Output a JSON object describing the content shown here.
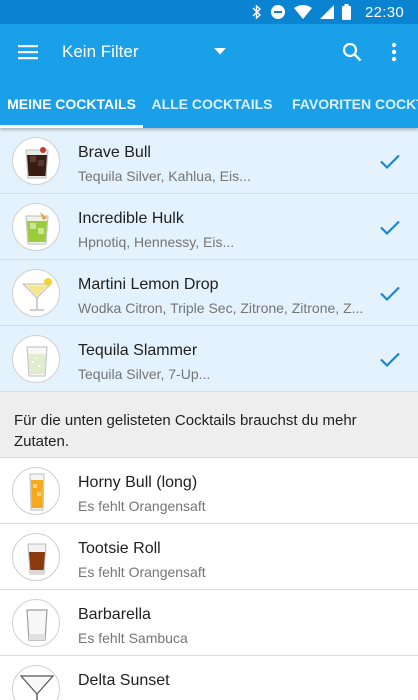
{
  "status_bar": {
    "time": "22:30",
    "icons": [
      "bluetooth-icon",
      "do-not-disturb-icon",
      "wifi-icon",
      "cell-signal-icon",
      "battery-icon"
    ]
  },
  "app_bar": {
    "filter_label": "Kein Filter",
    "icons": [
      "menu-icon",
      "dropdown-caret-icon",
      "search-icon",
      "more-vert-icon"
    ]
  },
  "tabs": [
    {
      "label": "MEINE COCKTAILS",
      "selected": true
    },
    {
      "label": "ALLE COCKTAILS",
      "selected": false
    },
    {
      "label": "FAVORITEN COCKTAILS",
      "selected": false
    }
  ],
  "colors": {
    "status_bar": "#0a84d0",
    "app_bar": "#1aa0e8",
    "available_row": "#e3f2fd",
    "check": "#1a84d0"
  },
  "available": [
    {
      "name": "Brave Bull",
      "ingredients": "Tequila Silver, Kahlua, Eis...",
      "image": "dark-lowball-glass-icon"
    },
    {
      "name": "Incredible Hulk",
      "ingredients": "Hpnotiq, Hennessy, Eis...",
      "image": "green-lowball-glass-icon"
    },
    {
      "name": "Martini Lemon Drop",
      "ingredients": "Wodka Citron, Triple Sec, Zitrone, Zitrone, Z...",
      "image": "martini-glass-icon"
    },
    {
      "name": "Tequila Slammer",
      "ingredients": "Tequila Silver, 7-Up...",
      "image": "clear-lowball-glass-icon"
    }
  ],
  "missing_info": "Für die unten gelisteten Cocktails brauchst du mehr Zutaten.",
  "missing": [
    {
      "name": "Horny Bull (long)",
      "missing": "Es fehlt Orangensaft",
      "image": "orange-highball-glass-icon"
    },
    {
      "name": "Tootsie Roll",
      "missing": "Es fehlt Orangensaft",
      "image": "shot-glass-icon"
    },
    {
      "name": "Barbarella",
      "missing": "Es fehlt Sambuca",
      "image": "empty-tumbler-icon"
    },
    {
      "name": "Delta Sunset",
      "missing": "",
      "image": "martini-glass-icon"
    }
  ]
}
